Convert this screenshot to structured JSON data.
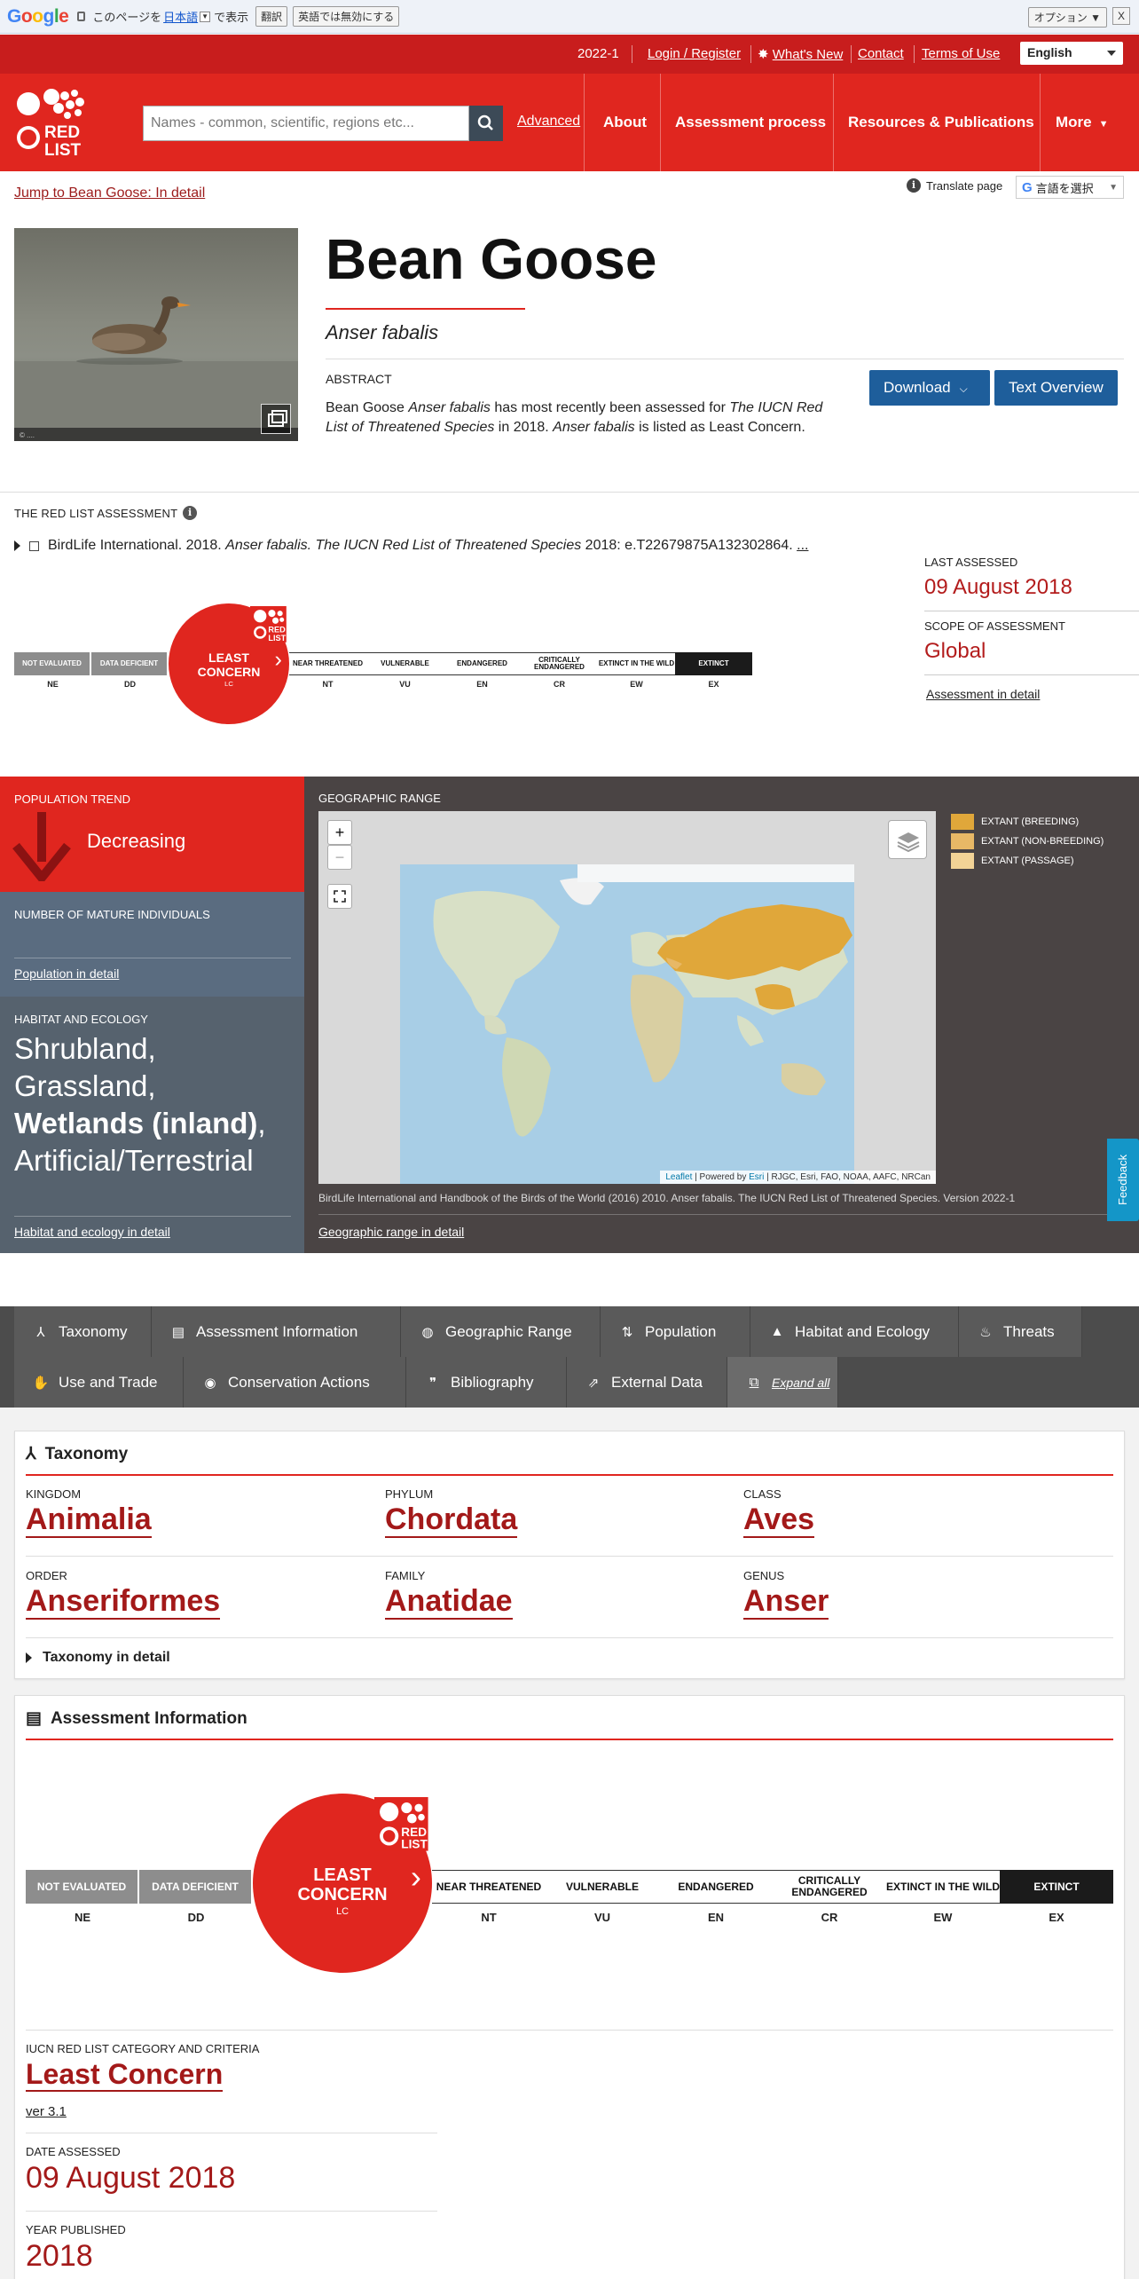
{
  "google_bar": {
    "prefix": "このページを",
    "language": "日本語",
    "suffix": "で表示",
    "translate_btn": "翻訳",
    "disable_btn": "英語では無効にする",
    "options_btn": "オプション ▼",
    "close_btn": "X"
  },
  "util_nav": {
    "version": "2022-1",
    "login": "Login / Register",
    "whats_new": "What's New",
    "contact": "Contact",
    "terms": "Terms of Use",
    "language": "English"
  },
  "main_nav": {
    "search_placeholder": "Names - common, scientific, regions etc...",
    "advanced": "Advanced",
    "items": [
      "About",
      "Assessment process",
      "Resources & Publications",
      "More"
    ]
  },
  "hero": {
    "jump_link": "Jump to Bean Goose: In detail",
    "translate_page": "Translate page",
    "translate_select": "言語を選択",
    "photo_credit": "© ....",
    "title": "Bean Goose",
    "scientific_name": "Anser fabalis",
    "abstract_label": "ABSTRACT",
    "abstract_1": "Bean Goose ",
    "abstract_2": "Anser fabalis",
    "abstract_3": " has most recently been assessed for ",
    "abstract_4": "The IUCN Red List of Threatened Species",
    "abstract_5": " in 2018. ",
    "abstract_6": "Anser fabalis",
    "abstract_7": " is listed as Least Concern.",
    "download_btn": "Download",
    "text_overview_btn": "Text Overview"
  },
  "assessment": {
    "label": "THE RED LIST ASSESSMENT",
    "citation_1": "BirdLife International. 2018. ",
    "citation_2": "Anser fabalis. The IUCN Red List of Threatened Species",
    "citation_3": " 2018: e.T22679875A132302864. ",
    "citation_more": "...",
    "last_assessed_label": "LAST ASSESSED",
    "last_assessed": "09 August 2018",
    "scope_label": "SCOPE OF ASSESSMENT",
    "scope": "Global",
    "detail_link": "Assessment in detail",
    "scale": [
      {
        "name": "NOT EVALUATED",
        "abbr": "NE"
      },
      {
        "name": "DATA DEFICIENT",
        "abbr": "DD"
      },
      {
        "name": "LEAST CONCERN",
        "abbr": "LC"
      },
      {
        "name": "NEAR THREATENED",
        "abbr": "NT"
      },
      {
        "name": "VULNERABLE",
        "abbr": "VU"
      },
      {
        "name": "ENDANGERED",
        "abbr": "EN"
      },
      {
        "name": "CRITICALLY ENDANGERED",
        "abbr": "CR"
      },
      {
        "name": "EXTINCT IN THE WILD",
        "abbr": "EW"
      },
      {
        "name": "EXTINCT",
        "abbr": "EX"
      }
    ],
    "lc_line1": "LEAST",
    "lc_line2": "CONCERN"
  },
  "summary": {
    "pop_trend_label": "POPULATION TREND",
    "pop_trend": "Decreasing",
    "mature_label": "NUMBER OF MATURE INDIVIDUALS",
    "pop_link": "Population in detail",
    "habitat_label": "HABITAT AND ECOLOGY",
    "habitat_1": "Shrubland,",
    "habitat_2": "Grassland,",
    "habitat_3": "Wetlands (inland)",
    "habitat_3b": ",",
    "habitat_4": "Artificial/Terrestrial",
    "habitat_link": "Habitat and ecology in detail",
    "geo_label": "GEOGRAPHIC RANGE",
    "legend": [
      "EXTANT (BREEDING)",
      "EXTANT (NON-BREEDING)",
      "EXTANT (PASSAGE)"
    ],
    "legend_colors": [
      "#e0a73a",
      "#e8b866",
      "#f2d396"
    ],
    "attribution_1": "Leaflet",
    "attribution_2": " | Powered by ",
    "attribution_3": "Esri",
    "attribution_4": " | RJGC, Esri, FAO, NOAA, AAFC, NRCan",
    "map_citation": "BirdLife International and Handbook of the Birds of the World (2016) 2010. Anser fabalis. The IUCN Red List of Threatened Species. Version 2022-1",
    "geo_link": "Geographic range in detail",
    "feedback": "Feedback"
  },
  "tabs": {
    "row1": [
      "Taxonomy",
      "Assessment Information",
      "Geographic Range",
      "Population",
      "Habitat and Ecology",
      "Threats"
    ],
    "row2": [
      "Use and Trade",
      "Conservation Actions",
      "Bibliography",
      "External Data"
    ],
    "expand_all": "Expand all"
  },
  "taxonomy": {
    "heading": "Taxonomy",
    "ranks": [
      {
        "label": "KINGDOM",
        "value": "Animalia"
      },
      {
        "label": "PHYLUM",
        "value": "Chordata"
      },
      {
        "label": "CLASS",
        "value": "Aves"
      },
      {
        "label": "ORDER",
        "value": "Anseriformes"
      },
      {
        "label": "FAMILY",
        "value": "Anatidae"
      },
      {
        "label": "GENUS",
        "value": "Anser"
      }
    ],
    "detail": "Taxonomy in detail"
  },
  "assessment_info": {
    "heading": "Assessment Information",
    "category_label": "IUCN RED LIST CATEGORY AND CRITERIA",
    "category": "Least Concern",
    "version": "ver 3.1",
    "date_label": "DATE ASSESSED",
    "date": "09 August 2018",
    "year_label": "YEAR PUBLISHED",
    "year": "2018"
  }
}
